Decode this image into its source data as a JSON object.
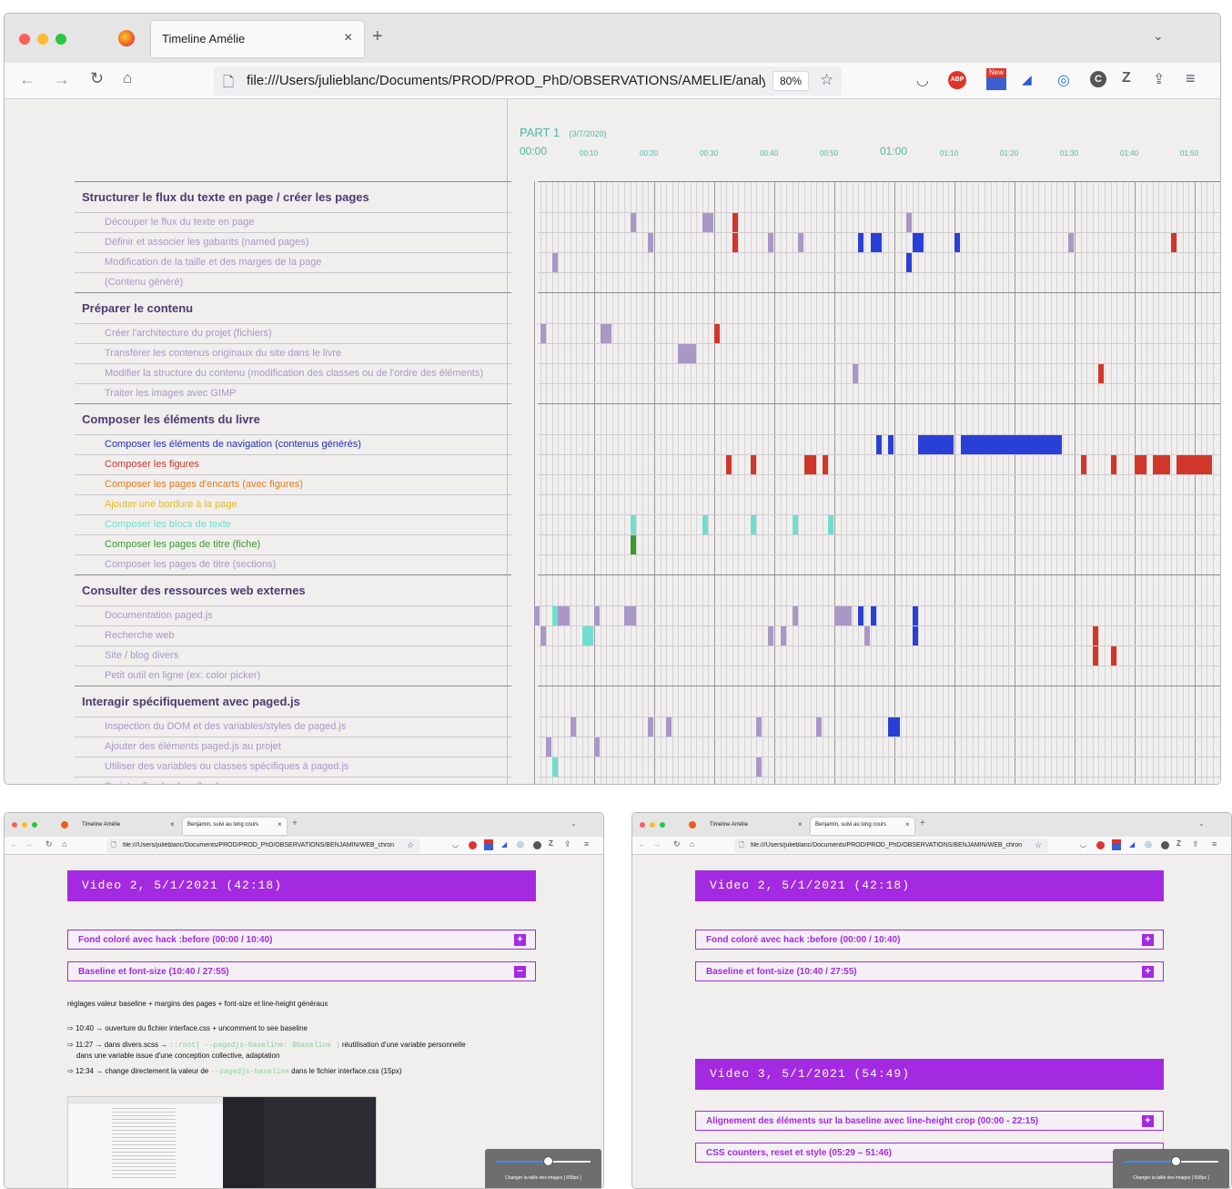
{
  "top_window": {
    "tab_title": "Timeline Amélie",
    "url": "file:///Users/julieblanc/Documents/PROD/PROD_PhD/OBSERVATIONS/AMELIE/analyse",
    "zoom": "80%",
    "part_label": "PART 1",
    "part_date": "(3/7/2020)",
    "time_ticks": [
      "00:00",
      "00:10",
      "00:20",
      "00:30",
      "00:40",
      "00:50",
      "01:00",
      "01:10",
      "01:20",
      "01:30",
      "01:40",
      "01:50"
    ],
    "categories": [
      {
        "title": "Structurer le flux du texte en page / créer les pages",
        "items": [
          {
            "label": "Découper le flux du texte en page",
            "color": "#a997c6"
          },
          {
            "label": "Définir et associer les gabarits (named pages)",
            "color": "#a997c6"
          },
          {
            "label": "Modification de la taille et des marges de la page",
            "color": "#a997c6"
          },
          {
            "label": "(Contenu généré)",
            "color": "#a997c6"
          }
        ]
      },
      {
        "title": "Préparer le contenu",
        "items": [
          {
            "label": "Créer l'architecture du projet (fichiers)",
            "color": "#a997c6"
          },
          {
            "label": "Transférer les contenus originaux du site dans le livre",
            "color": "#a997c6"
          },
          {
            "label": "Modifier la structure du contenu (modification des classes ou de l'ordre des éléments)",
            "color": "#a997c6"
          },
          {
            "label": "Traiter les images avec GIMP",
            "color": "#a997c6"
          }
        ]
      },
      {
        "title": "Composer les éléments du livre",
        "items": [
          {
            "label": "Composer les éléments de navigation (contenus générés)",
            "color": "#1f2fb8"
          },
          {
            "label": "Composer les figures",
            "color": "#d0362a"
          },
          {
            "label": "Composer les pages d'encarts (avec figures)",
            "color": "#e27a1e"
          },
          {
            "label": "Ajouter une bordure à la page",
            "color": "#e6b821"
          },
          {
            "label": "Composer les blocs de texte",
            "color": "#6fded0"
          },
          {
            "label": "Composer les pages de titre (fiche)",
            "color": "#3a9a2d"
          },
          {
            "label": "Composer les pages de titre (sections)",
            "color": "#a997c6"
          }
        ]
      },
      {
        "title": "Consulter des ressources web externes",
        "items": [
          {
            "label": "Documentation paged.js",
            "color": "#a997c6"
          },
          {
            "label": "Recherche web",
            "color": "#a997c6"
          },
          {
            "label": "Site / blog divers",
            "color": "#a997c6"
          },
          {
            "label": "Petit outil en ligne (ex: color picker)",
            "color": "#a997c6"
          }
        ]
      },
      {
        "title": "Interagir spécifiquement avec paged.js",
        "items": [
          {
            "label": "Inspection du DOM et des variables/styles de paged.js",
            "color": "#a997c6"
          },
          {
            "label": "Ajouter des éléments paged.js au projet",
            "color": "#a997c6"
          },
          {
            "label": "Utiliser des variables ou classes spécifiques à paged.js",
            "color": "#a997c6"
          },
          {
            "label": "Scripter (hooks, handlers)",
            "color": "#a997c6"
          }
        ]
      }
    ],
    "events": [
      [
        0,
        0,
        [
          [
            16,
            1,
            "#a997c6"
          ],
          [
            28,
            2,
            "#a997c6"
          ],
          [
            33,
            1,
            "#d0362a"
          ],
          [
            62,
            1,
            "#a997c6"
          ]
        ]
      ],
      [
        0,
        1,
        [
          [
            19,
            1,
            "#a997c6"
          ],
          [
            33,
            1,
            "#d0362a"
          ],
          [
            39,
            1,
            "#a997c6"
          ],
          [
            44,
            1,
            "#a997c6"
          ],
          [
            54,
            1,
            "#2a3fd6"
          ],
          [
            56,
            2,
            "#2a3fd6"
          ],
          [
            63,
            2,
            "#2a3fd6"
          ],
          [
            70,
            1,
            "#2a3fd6"
          ],
          [
            89,
            1,
            "#a997c6"
          ],
          [
            106,
            1,
            "#d0362a"
          ]
        ]
      ],
      [
        0,
        2,
        [
          [
            3,
            1,
            "#a997c6"
          ],
          [
            62,
            1,
            "#2a3fd6"
          ]
        ]
      ],
      [
        1,
        0,
        [
          [
            1,
            1,
            "#a997c6"
          ],
          [
            11,
            2,
            "#a997c6"
          ],
          [
            30,
            1,
            "#d0362a"
          ]
        ]
      ],
      [
        1,
        1,
        [
          [
            24,
            3,
            "#a997c6"
          ]
        ]
      ],
      [
        1,
        2,
        [
          [
            53,
            1,
            "#a997c6"
          ],
          [
            94,
            1,
            "#d0362a"
          ]
        ]
      ],
      [
        2,
        0,
        [
          [
            57,
            1,
            "#2a3fd6"
          ],
          [
            59,
            1,
            "#2a3fd6"
          ],
          [
            64,
            6,
            "#2a3fd6"
          ],
          [
            71,
            17,
            "#2a3fd6"
          ]
        ]
      ],
      [
        2,
        1,
        [
          [
            32,
            1,
            "#d0362a"
          ],
          [
            36,
            1,
            "#d0362a"
          ],
          [
            45,
            2,
            "#d0362a"
          ],
          [
            48,
            1,
            "#d0362a"
          ],
          [
            91,
            1,
            "#d0362a"
          ],
          [
            96,
            1,
            "#d0362a"
          ],
          [
            100,
            2,
            "#d0362a"
          ],
          [
            103,
            3,
            "#d0362a"
          ],
          [
            107,
            6,
            "#d0362a"
          ]
        ]
      ],
      [
        2,
        4,
        [
          [
            16,
            1,
            "#6fded0"
          ],
          [
            28,
            1,
            "#6fded0"
          ],
          [
            36,
            1,
            "#6fded0"
          ],
          [
            43,
            1,
            "#6fded0"
          ],
          [
            49,
            1,
            "#6fded0"
          ]
        ]
      ],
      [
        2,
        5,
        [
          [
            16,
            1,
            "#3a9a2d"
          ]
        ]
      ],
      [
        3,
        0,
        [
          [
            0,
            1,
            "#a997c6"
          ],
          [
            3,
            1,
            "#6fded0"
          ],
          [
            4,
            2,
            "#a997c6"
          ],
          [
            10,
            1,
            "#a997c6"
          ],
          [
            15,
            2,
            "#a997c6"
          ],
          [
            43,
            1,
            "#a997c6"
          ],
          [
            50,
            3,
            "#a997c6"
          ],
          [
            54,
            1,
            "#2a3fd6"
          ],
          [
            56,
            1,
            "#2a3fd6"
          ],
          [
            63,
            1,
            "#2a3fd6"
          ]
        ]
      ],
      [
        3,
        1,
        [
          [
            1,
            1,
            "#a997c6"
          ],
          [
            8,
            2,
            "#6fded0"
          ],
          [
            39,
            1,
            "#a997c6"
          ],
          [
            41,
            1,
            "#a997c6"
          ],
          [
            55,
            1,
            "#a997c6"
          ],
          [
            63,
            1,
            "#2a3fd6"
          ],
          [
            93,
            1,
            "#d0362a"
          ]
        ]
      ],
      [
        3,
        2,
        [
          [
            93,
            1,
            "#d0362a"
          ],
          [
            96,
            1,
            "#d0362a"
          ]
        ]
      ],
      [
        4,
        0,
        [
          [
            6,
            1,
            "#a997c6"
          ],
          [
            19,
            1,
            "#a997c6"
          ],
          [
            22,
            1,
            "#a997c6"
          ],
          [
            37,
            1,
            "#a997c6"
          ],
          [
            47,
            1,
            "#a997c6"
          ],
          [
            59,
            2,
            "#2a3fd6"
          ]
        ]
      ],
      [
        4,
        1,
        [
          [
            2,
            1,
            "#a997c6"
          ],
          [
            10,
            1,
            "#a997c6"
          ]
        ]
      ],
      [
        4,
        2,
        [
          [
            3,
            1,
            "#6fded0"
          ],
          [
            37,
            1,
            "#a997c6"
          ]
        ]
      ]
    ]
  },
  "left_window": {
    "tabs": [
      "Timeline Amélie",
      "Benjamin, suivi au long cours"
    ],
    "url": "file:///Users/julieblanc/Documents/PROD/PROD_PhD/OBSERVATIONS/BENJAMIN/WEB_chron",
    "video_title": "Video 2, 5/1/2021 (42:18)",
    "sections": [
      {
        "label": "Fond coloré avec hack :before (00:00 / 10:40)",
        "toggle": "+"
      },
      {
        "label": "Baseline et font-size (10:40 / 27:55)",
        "toggle": "−"
      }
    ],
    "intro": "réglages valeur baseline + margins des pages + font-size et line-height généraux",
    "notes": [
      {
        "arrow": "⇨",
        "text": "10:40 → ouverture du fichier interface.css + uncomment to see baseline"
      },
      {
        "arrow": "⇨",
        "pre": "11:27 → dans divers.scss → ",
        "code": "::root( --pagedjs-baseline: $baseline )",
        "post": " réutilisation d'une variable personnelle"
      },
      {
        "arrow": "",
        "text": "dans une variable issue d'une conception collective, adaptation"
      },
      {
        "arrow": "⇨",
        "pre": "12:34 → change directement la valeur de ",
        "code": "--pagedjs-baseline",
        "post": " dans le fichier interface.css (15px)"
      }
    ],
    "slider_label": "Changer la taille des images [ 658px ]",
    "slider_value": 0.55
  },
  "right_window": {
    "tabs": [
      "Timeline Amélie",
      "Benjamin, suivi au long cours"
    ],
    "url": "file:///Users/julieblanc/Documents/PROD/PROD_PhD/OBSERVATIONS/BENJAMIN/WEB_chron",
    "videos": [
      {
        "title": "Video 2, 5/1/2021 (42:18)",
        "sections": [
          {
            "label": "Fond coloré avec hack :before (00:00 / 10:40)",
            "toggle": "+"
          },
          {
            "label": "Baseline et font-size (10:40 / 27:55)",
            "toggle": "+"
          }
        ]
      },
      {
        "title": "Video 3, 5/1/2021 (54:49)",
        "sections": [
          {
            "label": "Alignement des éléments sur la baseline avec line-height crop (00:00 - 22:15)",
            "toggle": "+"
          },
          {
            "label": "CSS counters, reset et style (05:29 – 51:46)",
            "toggle": "+"
          }
        ]
      }
    ],
    "slider_label": "Changer la taille des images [ 658px ]",
    "slider_value": 0.55
  }
}
